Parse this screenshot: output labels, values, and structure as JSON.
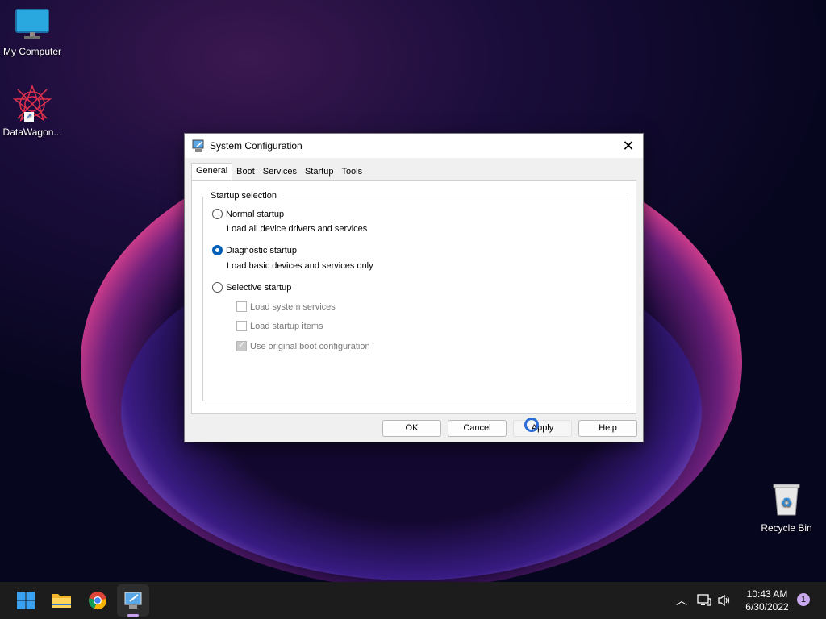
{
  "desktop": {
    "icons": [
      {
        "label": "My Computer"
      },
      {
        "label": "DataWagon..."
      },
      {
        "label": "Recycle Bin"
      }
    ]
  },
  "dialog": {
    "title": "System Configuration",
    "tabs": [
      {
        "label": "General"
      },
      {
        "label": "Boot"
      },
      {
        "label": "Services"
      },
      {
        "label": "Startup"
      },
      {
        "label": "Tools"
      }
    ],
    "group_label": "Startup selection",
    "normal": {
      "label": "Normal startup",
      "desc": "Load all device drivers and services",
      "selected": false
    },
    "diagnostic": {
      "label": "Diagnostic startup",
      "desc": "Load basic devices and services only",
      "selected": true
    },
    "selective": {
      "label": "Selective startup",
      "selected": false
    },
    "options": [
      {
        "label": "Load system services",
        "checked": false
      },
      {
        "label": "Load startup items",
        "checked": false
      },
      {
        "label": "Use original boot configuration",
        "checked": true
      }
    ],
    "buttons": {
      "ok": "OK",
      "cancel": "Cancel",
      "apply": "Apply",
      "help": "Help"
    }
  },
  "taskbar": {
    "clock_time": "10:43 AM",
    "clock_date": "6/30/2022",
    "notification_count": "1"
  },
  "colors": {
    "accent": "#005fb8",
    "taskbar": "#1c1c1c"
  }
}
